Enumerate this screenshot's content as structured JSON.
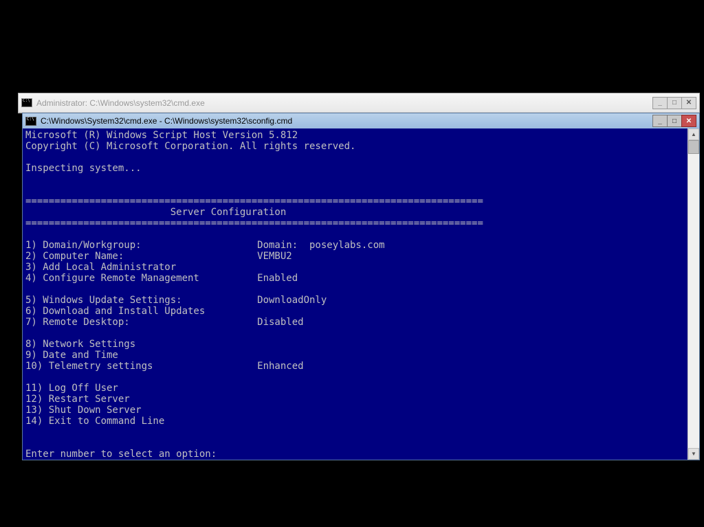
{
  "back_window": {
    "title": "Administrator: C:\\Windows\\system32\\cmd.exe",
    "min": "_",
    "max": "□",
    "close": "✕"
  },
  "front_window": {
    "title": "C:\\Windows\\System32\\cmd.exe - C:\\Windows\\system32\\sconfig.cmd",
    "min": "_",
    "max": "□",
    "close": "✕"
  },
  "console": {
    "header_line1": "Microsoft (R) Windows Script Host Version 5.812",
    "header_line2": "Copyright (C) Microsoft Corporation. All rights reserved.",
    "inspecting": "Inspecting system...",
    "divider": "===============================================================================",
    "title": "                         Server Configuration",
    "items": [
      {
        "label": "1) Domain/Workgroup:",
        "value": "Domain:  poseylabs.com"
      },
      {
        "label": "2) Computer Name:",
        "value": "VEMBU2"
      },
      {
        "label": "3) Add Local Administrator",
        "value": ""
      },
      {
        "label": "4) Configure Remote Management",
        "value": "Enabled"
      },
      {
        "label": "",
        "value": ""
      },
      {
        "label": "5) Windows Update Settings:",
        "value": "DownloadOnly"
      },
      {
        "label": "6) Download and Install Updates",
        "value": ""
      },
      {
        "label": "7) Remote Desktop:",
        "value": "Disabled"
      },
      {
        "label": "",
        "value": ""
      },
      {
        "label": "8) Network Settings",
        "value": ""
      },
      {
        "label": "9) Date and Time",
        "value": ""
      },
      {
        "label": "10) Telemetry settings",
        "value": "Enhanced"
      },
      {
        "label": "",
        "value": ""
      },
      {
        "label": "11) Log Off User",
        "value": ""
      },
      {
        "label": "12) Restart Server",
        "value": ""
      },
      {
        "label": "13) Shut Down Server",
        "value": ""
      },
      {
        "label": "14) Exit to Command Line",
        "value": ""
      }
    ],
    "prompt": "Enter number to select an option: "
  }
}
